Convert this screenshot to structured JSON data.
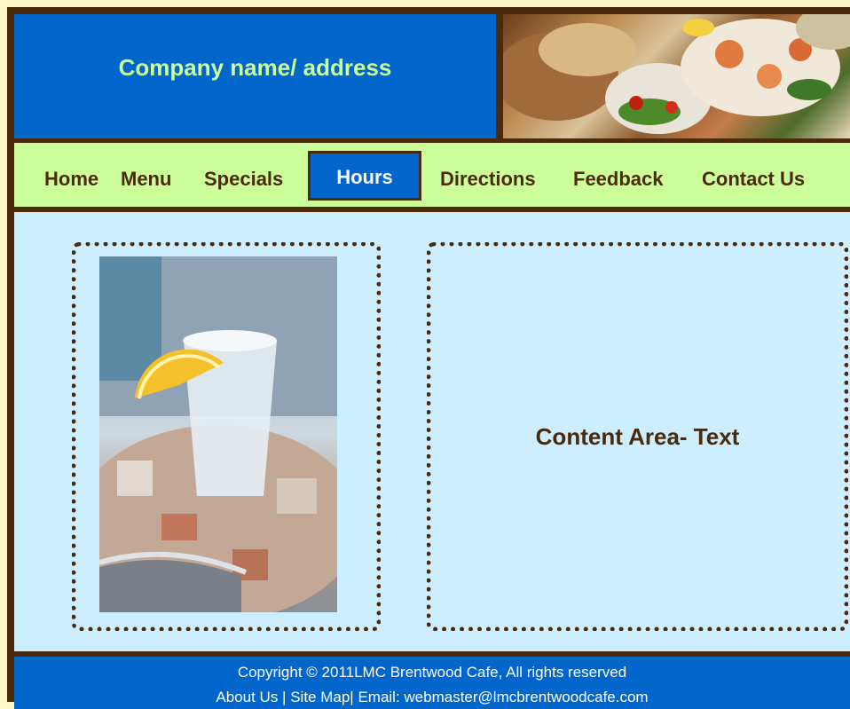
{
  "header": {
    "company": "Company name/ address"
  },
  "nav": {
    "items": [
      "Home",
      "Menu",
      "Specials",
      "Hours",
      "Directions",
      "Feedback",
      "Contact Us"
    ],
    "active": "Hours"
  },
  "content": {
    "text": "Content Area- Text"
  },
  "footer": {
    "copyright": "Copyright © 2011LMC Brentwood Cafe, All rights reserved",
    "links": {
      "about": "About Us",
      "sep1": " | ",
      "sitemap": "Site Map",
      "sep2": "| ",
      "email": "Email: webmaster@lmcbrentwoodcafe.com"
    }
  },
  "colors": {
    "frame": "#4a2a0a",
    "blue": "#0066cc",
    "lime": "#ccff99",
    "sky": "#cceeff"
  }
}
